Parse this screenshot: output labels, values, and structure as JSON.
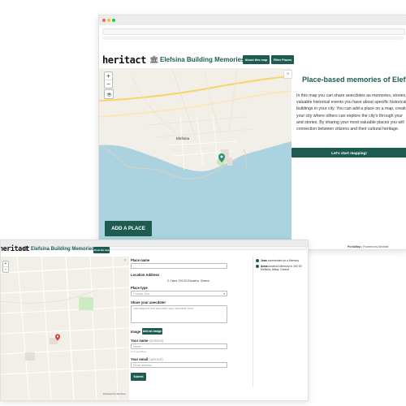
{
  "colors": {
    "accent": "#1e5c52",
    "water": "#aad3df",
    "land": "#f2efe9",
    "pin": "#2a8f7a",
    "pin_back": "#d33f3f"
  },
  "app": {
    "logo": "heritact",
    "bank_icon": "bank-icon",
    "title": "Elefsina Building Memories",
    "nav": {
      "about_label": "About this map",
      "filter_label": "Filter Places"
    }
  },
  "front": {
    "map": {
      "zoom_in": "+",
      "zoom_out": "−",
      "layers_icon": "layers-icon",
      "town_label": "Elefsina",
      "add_place_label": "ADD A PLACE",
      "attribution": "© CARTO © OpenStreetMap contributors"
    },
    "panel": {
      "close": "×",
      "heading": "Place-based memories of Elefsina",
      "body_lines": [
        "In this map you can share anecdotes as memories, stories, and",
        "valuable historical events you have about specific historical",
        "buildings in your city. You can add a place on a map, creating",
        "your city where others can explore the city's through your",
        "and stories. By sharing your most valuable places you will",
        "connection between citizens and their cultural heritage."
      ],
      "cta_label": "Let's start mapping!",
      "footer_prefix": "PortalMap",
      "footer_middle": " | Powered by ",
      "footer_brand": "Sentinel"
    }
  },
  "back": {
    "map": {
      "zoom_in": "+",
      "zoom_out": "−"
    },
    "form": {
      "close": "×",
      "place_name_label": "Place name",
      "location_label": "Location Address",
      "location_value": "Σ. Γκίκα, 192 00 Ελευσίνα, Greece",
      "place_type_label": "Place type",
      "place_type_value": "Choose One",
      "anecdote_label": "Share your anecdote!",
      "anecdote_placeholder": "Use elapsed text and write your anecdote here",
      "image_label": "Image",
      "add_image_label": "Add an Image",
      "name_label": "Your name",
      "name_optional": "(optional)",
      "name_placeholder": "Name",
      "name_hint": "If no specified...",
      "email_label": "Your email",
      "email_optional": "(optional)",
      "email_placeholder": "Email address",
      "submit_label": "Submit"
    },
    "feed": [
      {
        "user": "Jean",
        "text": "commented on a Memory"
      },
      {
        "user": "Anna",
        "text": "posted a Memory in 192 00 Elefsina, Attica, Greece"
      }
    ],
    "footer": "Powered by Sentinel"
  }
}
